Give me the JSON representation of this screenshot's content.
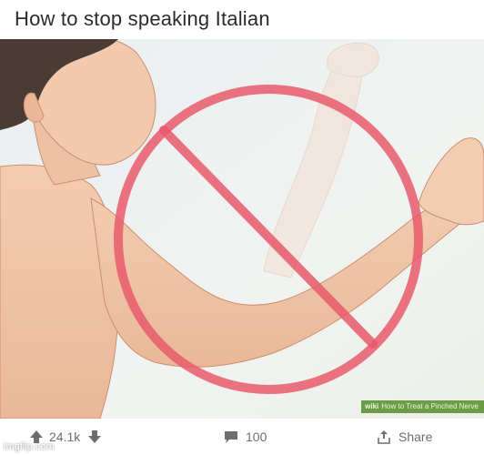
{
  "title": "How to stop speaking Italian",
  "image": {
    "wiki_badge_brand": "wiki",
    "wiki_badge_text": "How to Treat a Pinched Nerve",
    "prohibition_color": "#e85a6c"
  },
  "actions": {
    "upvote_count": "24.1k",
    "comment_count": "100",
    "share_label": "Share"
  },
  "watermark": "imgflip.com"
}
